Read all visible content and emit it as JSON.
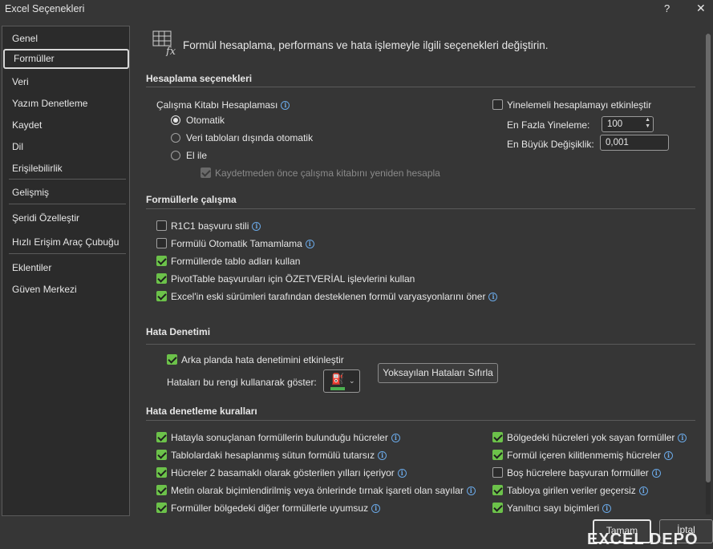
{
  "window": {
    "title": "Excel Seçenekleri",
    "help": "?",
    "close": "✕"
  },
  "sidebar": {
    "items": [
      "Genel",
      "Formüller",
      "Veri",
      "Yazım Denetleme",
      "Kaydet",
      "Dil",
      "Erişilebilirlik",
      "Gelişmiş",
      "Şeridi Özelleştir",
      "Hızlı Erişim Araç Çubuğu",
      "Eklentiler",
      "Güven Merkezi"
    ],
    "selected": "Formüller"
  },
  "header": {
    "text": "Formül hesaplama, performans ve hata işlemeyle ilgili seçenekleri değiştirin.",
    "icon": "formula-sheet-icon"
  },
  "calc": {
    "title": "Hesaplama seçenekleri",
    "workbook_label": "Çalışma Kitabı Hesaplaması",
    "radio_auto": "Otomatik",
    "radio_auto_except": "Veri tabloları dışında otomatik",
    "radio_manual": "El ile",
    "recalc_before_save": "Kaydetmeden önce çalışma kitabını yeniden hesapla",
    "iterative": "Yinelemeli hesaplamayı etkinleştir",
    "max_iter_label": "En Fazla Yineleme:",
    "max_iter_value": "100",
    "max_change_label": "En Büyük Değişiklik:",
    "max_change_value": "0,001"
  },
  "working": {
    "title": "Formüllerle çalışma",
    "r1c1": "R1C1 başvuru stili",
    "autocomplete": "Formülü Otomatik Tamamlama",
    "table_names": "Formüllerde tablo adları kullan",
    "getpivot": "PivotTable başvuruları için ÖZETVERİAL işlevlerini kullan",
    "variants": "Excel'in eski sürümleri tarafından desteklenen formül varyasyonlarını öner"
  },
  "errors": {
    "title": "Hata Denetimi",
    "background": "Arka planda hata denetimini etkinleştir",
    "color_label": "Hataları bu rengi kullanarak göster:",
    "color": "#4caf50",
    "reset_button": "Yoksayılan Hataları Sıfırla"
  },
  "rules": {
    "title": "Hata denetleme kuralları",
    "left": [
      "Hatayla sonuçlanan formüllerin bulunduğu hücreler",
      "Tablolardaki hesaplanmış sütun formülü tutarsız",
      "Hücreler 2 basamaklı olarak gösterilen yılları içeriyor",
      "Metin olarak biçimlendirilmiş veya önlerinde tırnak işareti olan sayılar",
      "Formüller bölgedeki diğer formüllerle uyumsuz"
    ],
    "right": [
      "Bölgedeki hücreleri yok sayan formüller",
      "Formül içeren kilitlenmemiş hücreler",
      "Boş hücrelere başvuran formüller",
      "Tabloya girilen veriler geçersiz",
      "Yanıltıcı sayı biçimleri"
    ]
  },
  "footer": {
    "ok": "Tamam",
    "cancel": "İptal",
    "watermark": "EXCEL DEPO"
  }
}
